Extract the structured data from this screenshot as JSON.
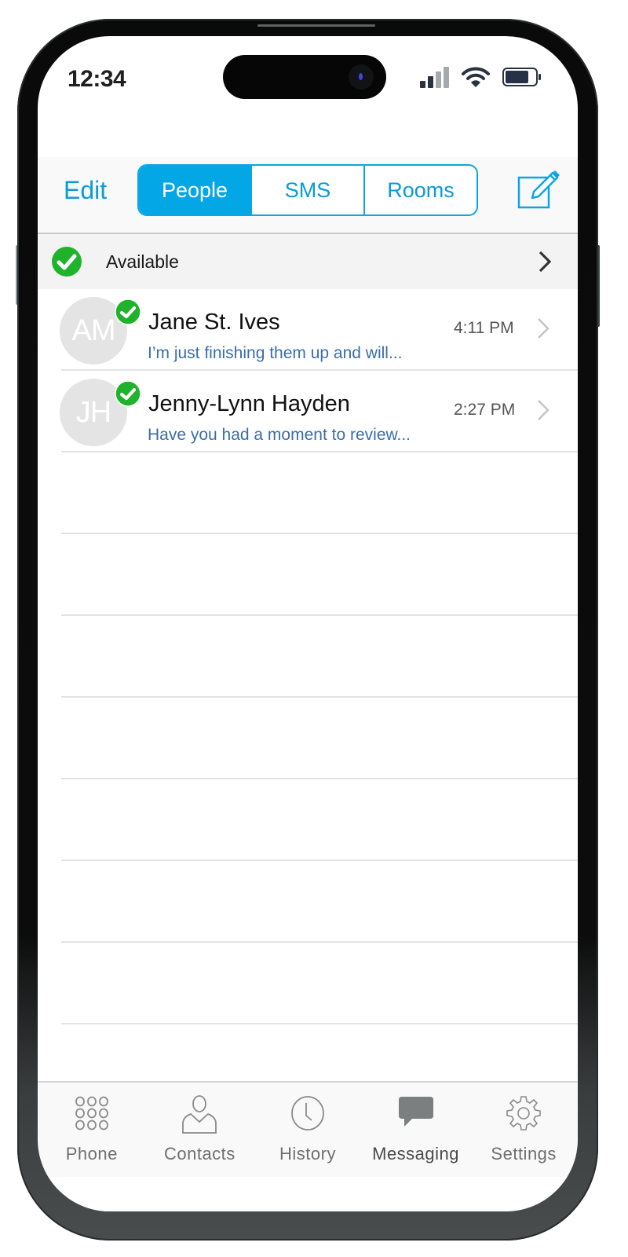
{
  "status_bar": {
    "time": "12:34",
    "icons": [
      "cellular-signal-icon",
      "wifi-icon",
      "battery-icon"
    ]
  },
  "toolbar": {
    "edit_label": "Edit",
    "segments": [
      {
        "label": "People",
        "active": true
      },
      {
        "label": "SMS",
        "active": false
      },
      {
        "label": "Rooms",
        "active": false
      }
    ],
    "compose_icon": "compose-icon"
  },
  "availability": {
    "status": "Available",
    "icon": "check-circle-icon",
    "status_color": "#1fb32c"
  },
  "conversations": [
    {
      "initials": "AM",
      "name": "Jane St. Ives",
      "time": "4:11 PM",
      "preview": "I’m just finishing them up and will...",
      "presence": "available"
    },
    {
      "initials": "JH",
      "name": "Jenny-Lynn Hayden",
      "time": "2:27 PM",
      "preview": "Have you had a moment to review...",
      "presence": "available"
    }
  ],
  "tab_bar": {
    "tabs": [
      {
        "label": "Phone",
        "icon": "keypad-icon",
        "active": false
      },
      {
        "label": "Contacts",
        "icon": "person-icon",
        "active": false
      },
      {
        "label": "History",
        "icon": "clock-icon",
        "active": false
      },
      {
        "label": "Messaging",
        "icon": "chat-bubble-icon",
        "active": true
      },
      {
        "label": "Settings",
        "icon": "gear-icon",
        "active": false
      }
    ]
  },
  "colors": {
    "accent": "#03a7e5",
    "preview_text": "#3a6ea8",
    "presence_green": "#1fb32c"
  }
}
